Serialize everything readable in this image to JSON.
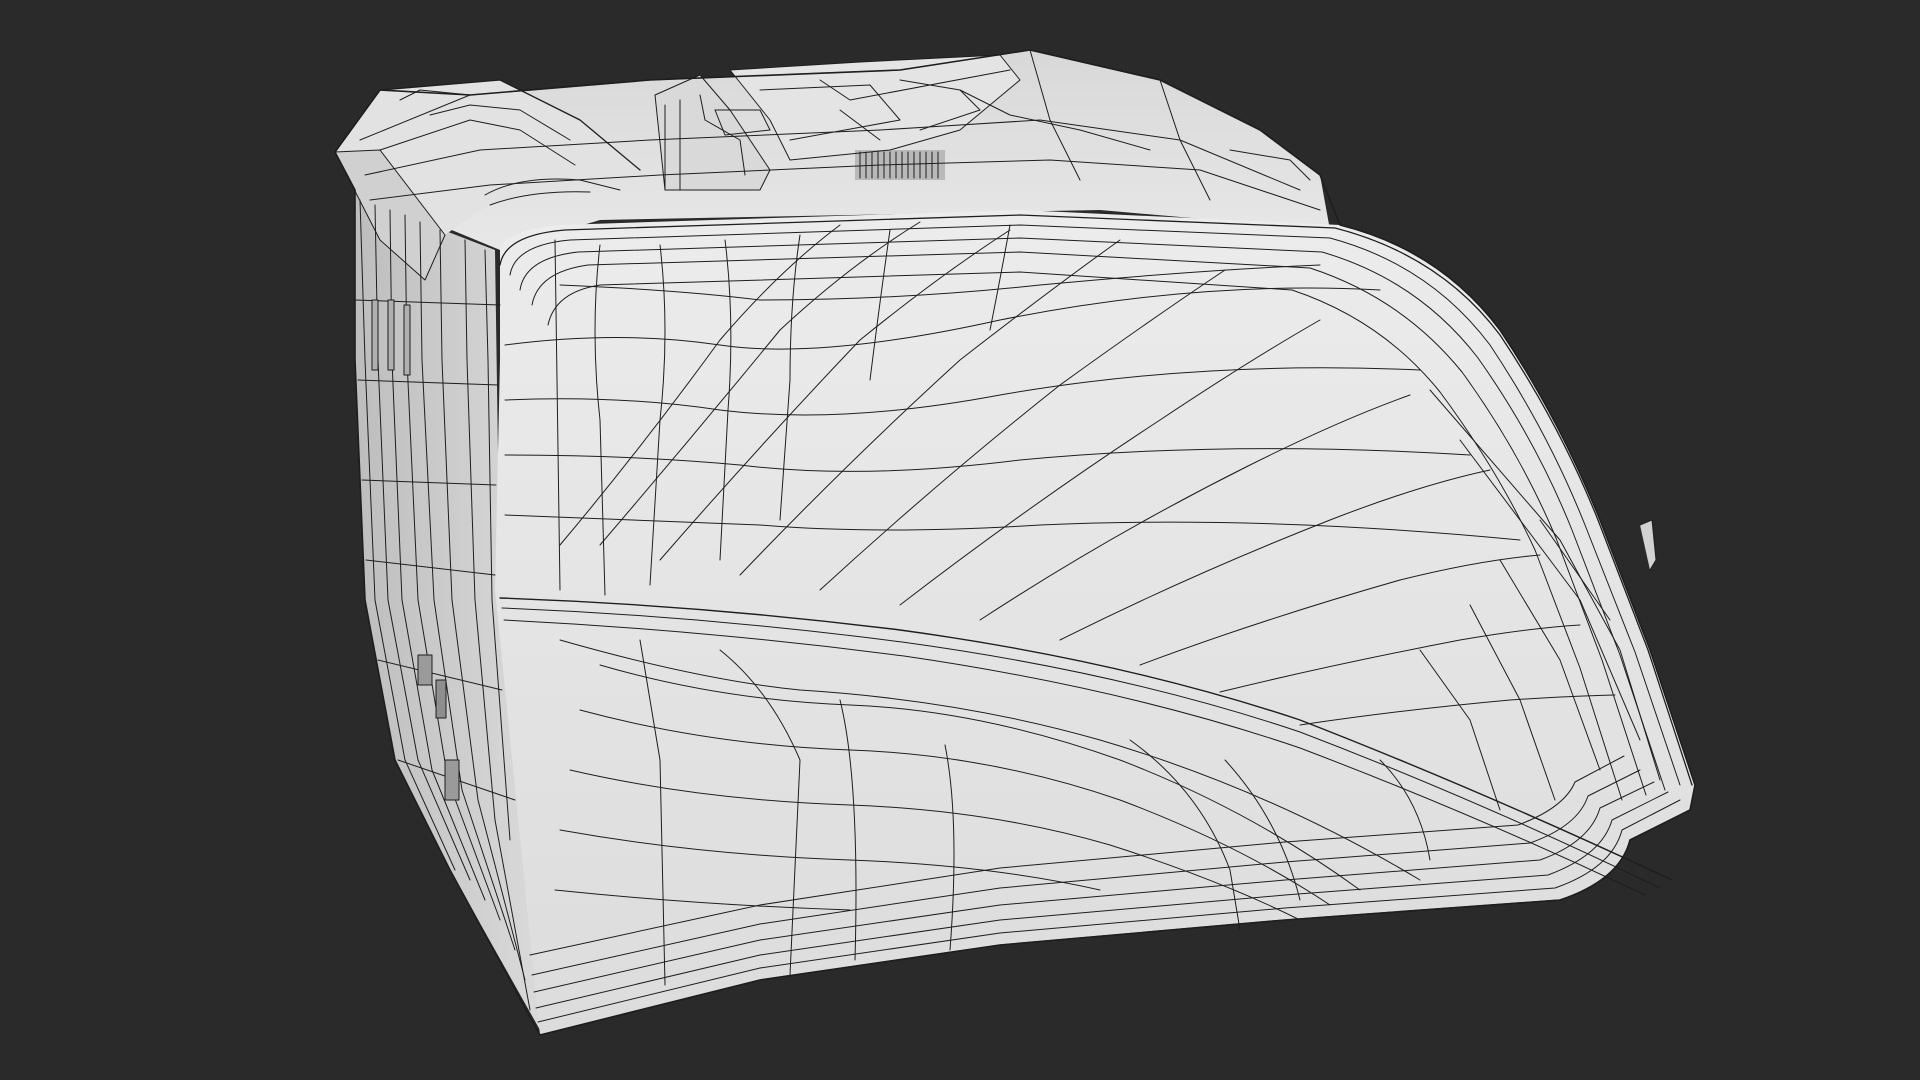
{
  "scene": {
    "subject": "wireframe-3d-model",
    "background_color": "#2a2a2a",
    "mesh_fill_color": "#e6e6e6",
    "mesh_shade_color": "#cfcfcf",
    "wire_color": "#1e1e1e"
  }
}
